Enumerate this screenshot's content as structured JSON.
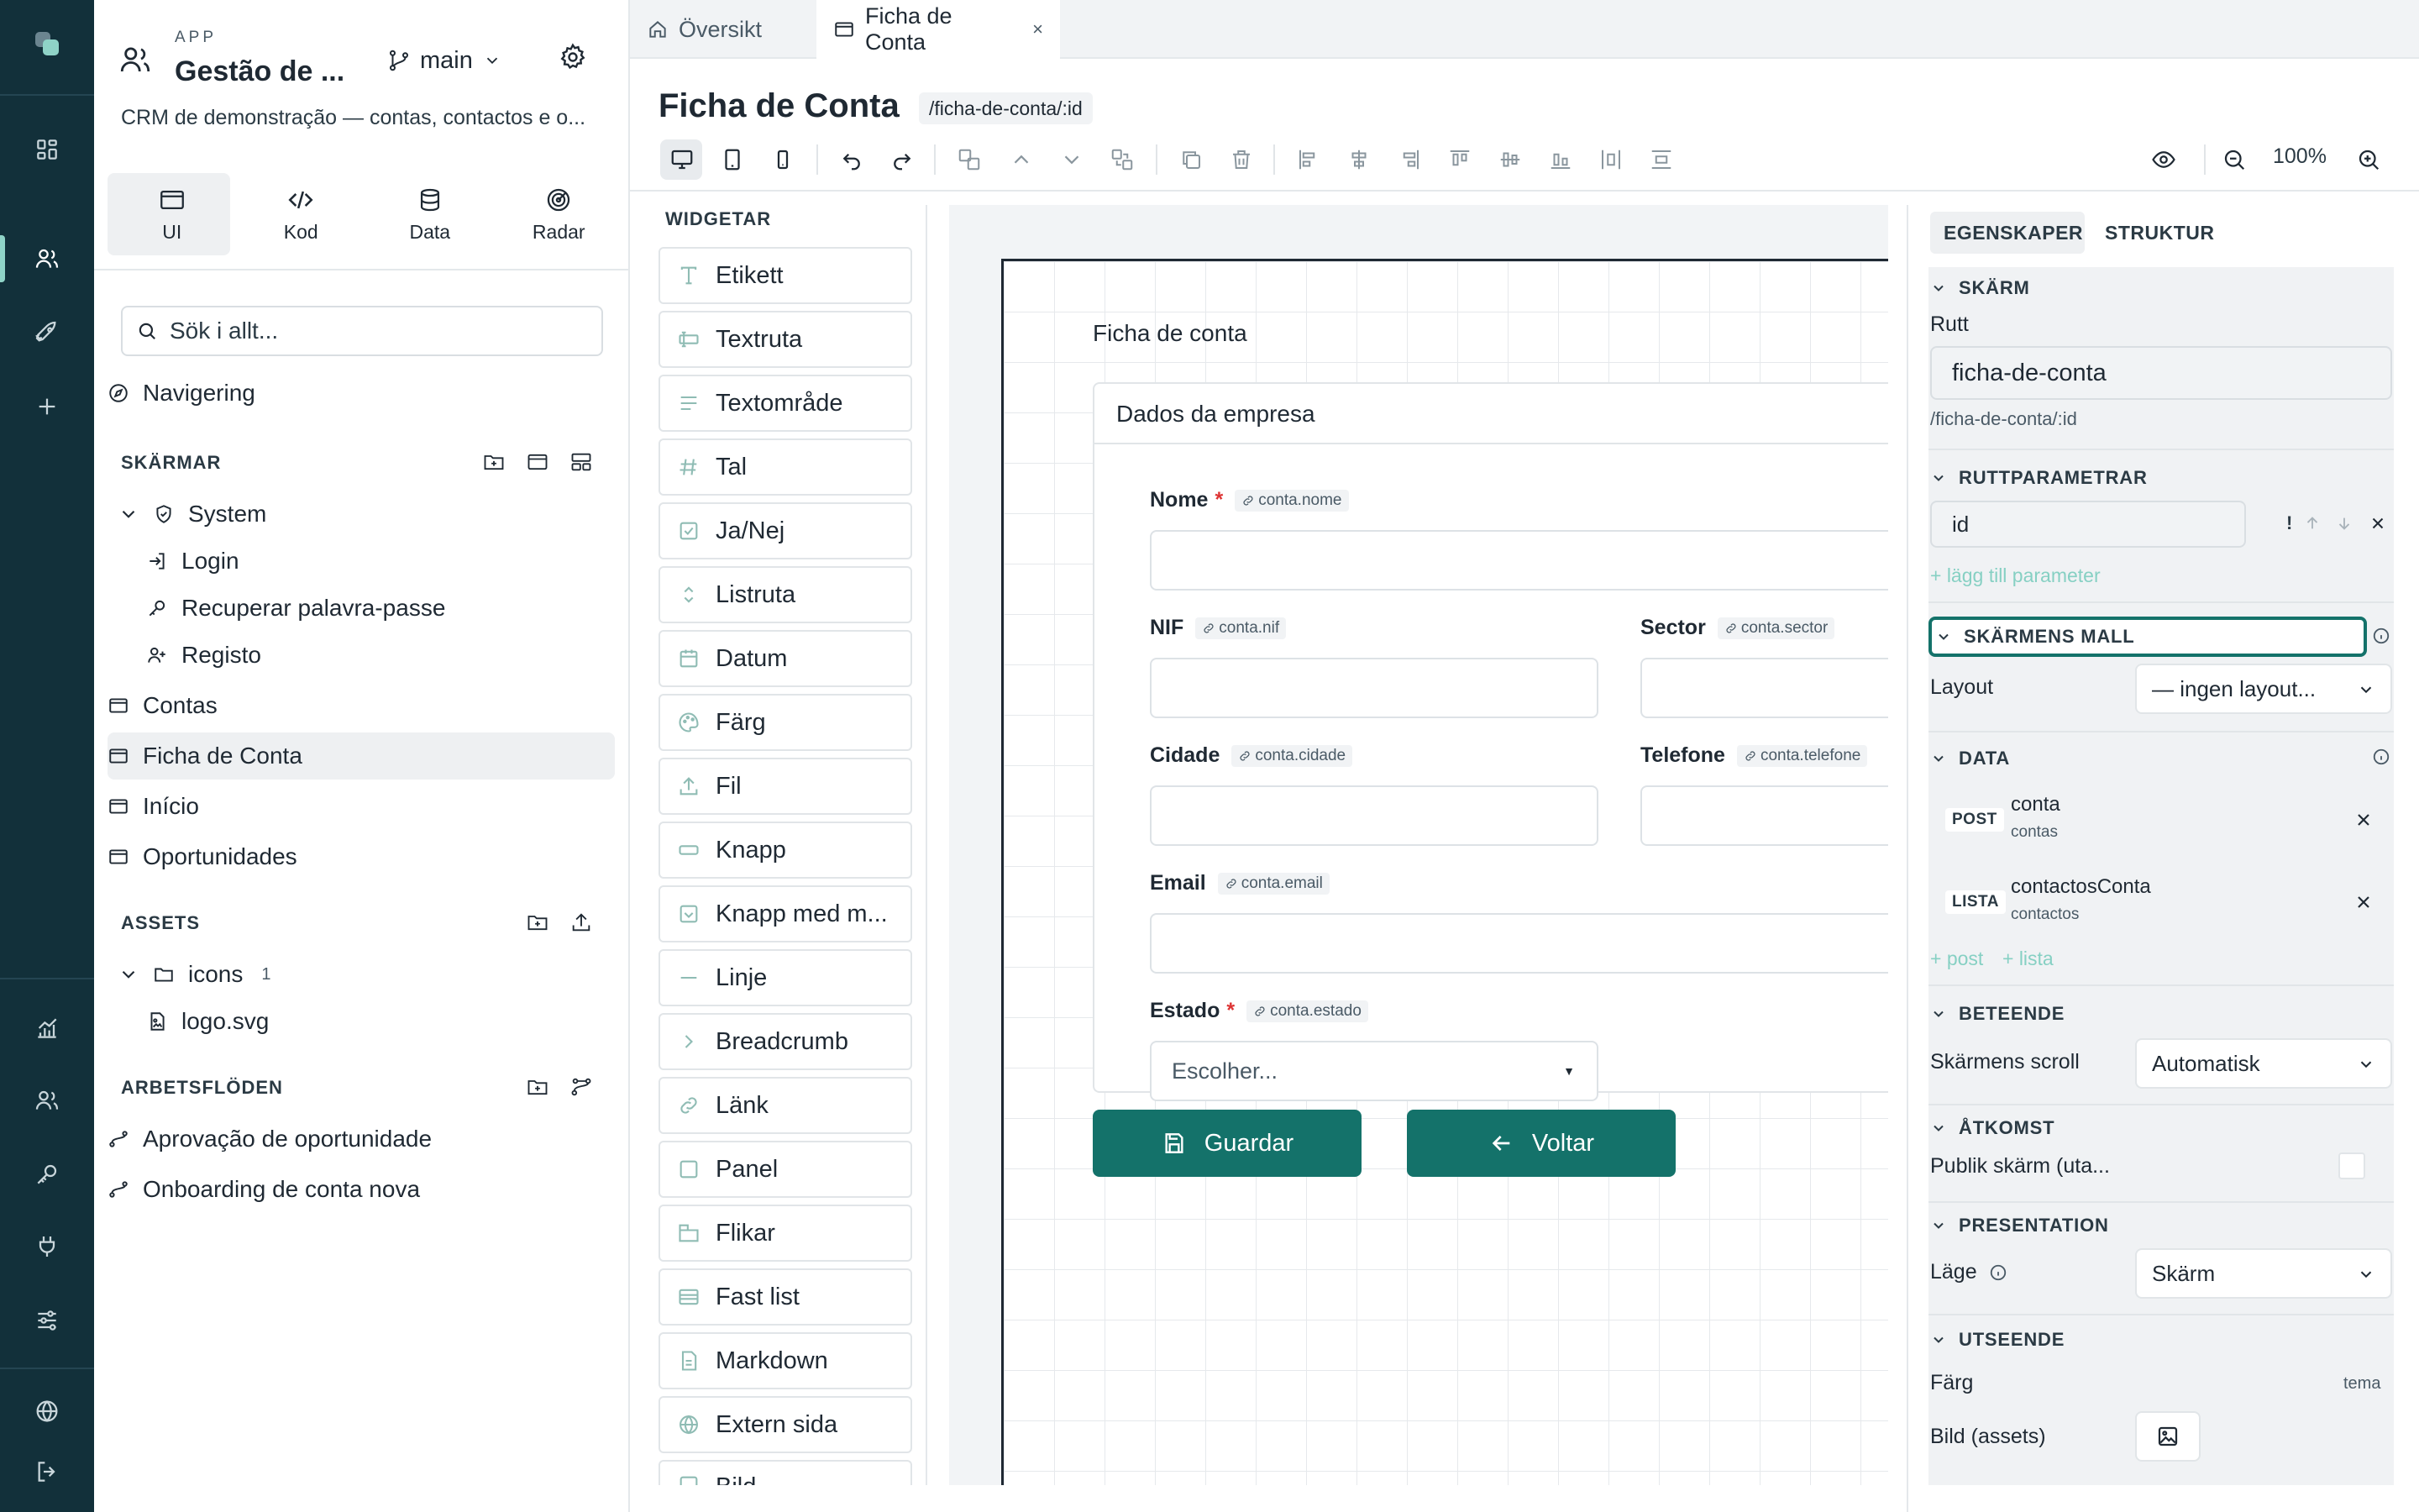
{
  "app": {
    "kicker": "APP",
    "name": "Gestão de ...",
    "branch": "main",
    "description": "CRM de demonstração — contas, contactos e o..."
  },
  "mode_tabs": [
    {
      "label": "UI",
      "icon": "window-icon"
    },
    {
      "label": "Kod",
      "icon": "code-icon"
    },
    {
      "label": "Data",
      "icon": "database-icon"
    },
    {
      "label": "Radar",
      "icon": "radar-icon"
    }
  ],
  "search": {
    "placeholder": "Sök i allt..."
  },
  "navigation_label": "Navigering",
  "screens": {
    "title": "SKÄRMAR",
    "group": "System",
    "system_items": [
      "Login",
      "Recuperar palavra-passe",
      "Registo"
    ],
    "items": [
      "Contas",
      "Ficha de Conta",
      "Início",
      "Oportunidades"
    ],
    "selected": "Ficha de Conta"
  },
  "assets": {
    "title": "ASSETS",
    "folder": "icons",
    "folder_count": "1",
    "file": "logo.svg"
  },
  "workflows": {
    "title": "ARBETSFLÖDEN",
    "items": [
      "Aprovação de oportunidade",
      "Onboarding de conta nova"
    ]
  },
  "tabs": [
    {
      "label": "Översikt",
      "active": false
    },
    {
      "label": "Ficha de Conta",
      "active": true,
      "close": "×"
    }
  ],
  "page": {
    "title": "Ficha de Conta",
    "route": "/ficha-de-conta/:id"
  },
  "toolbar": {
    "zoom": "100%"
  },
  "widgets": {
    "title": "WIDGETAR",
    "items": [
      "Etikett",
      "Textruta",
      "Textområde",
      "Tal",
      "Ja/Nej",
      "Listruta",
      "Datum",
      "Färg",
      "Fil",
      "Knapp",
      "Knapp med m...",
      "Linje",
      "Breadcrumb",
      "Länk",
      "Panel",
      "Flikar",
      "Fast list",
      "Markdown",
      "Extern sida",
      "Bild"
    ]
  },
  "canvas": {
    "heading": "Ficha de conta",
    "panel_title": "Dados da empresa",
    "fields": {
      "nome": {
        "label": "Nome",
        "bind": "conta.nome"
      },
      "nif": {
        "label": "NIF",
        "bind": "conta.nif"
      },
      "sector": {
        "label": "Sector",
        "bind": "conta.sector"
      },
      "cidade": {
        "label": "Cidade",
        "bind": "conta.cidade"
      },
      "telefone": {
        "label": "Telefone",
        "bind": "conta.telefone"
      },
      "email": {
        "label": "Email",
        "bind": "conta.email"
      },
      "estado": {
        "label": "Estado",
        "bind": "conta.estado",
        "placeholder": "Escolher..."
      }
    },
    "required_mark": "*",
    "buttons": {
      "save": "Guardar",
      "back": "Voltar"
    }
  },
  "props": {
    "tabs": [
      "EGENSKAPER",
      "STRUKTUR"
    ],
    "screen_section": "SKÄRM",
    "route_label": "Rutt",
    "route_value": "ficha-de-conta",
    "route_hint": "/ficha-de-conta/:id",
    "params_section": "RUTTPARAMETRAR",
    "param_value": "id",
    "param_flag": "!",
    "add_param": "+ lägg till parameter",
    "template_section": "SKÄRMENS MALL",
    "layout_label": "Layout",
    "layout_value": "— ingen layout...",
    "data_section": "DATA",
    "data_items": [
      {
        "method": "POST",
        "name": "conta",
        "source": "contas"
      },
      {
        "method": "LISTA",
        "name": "contactosConta",
        "source": "contactos"
      }
    ],
    "add_post": "+ post",
    "add_list": "+ lista",
    "behavior_section": "BETEENDE",
    "scroll_label": "Skärmens scroll",
    "scroll_value": "Automatisk",
    "access_section": "ÅTKOMST",
    "public_label": "Publik skärm (uta...",
    "presentation_section": "PRESENTATION",
    "mode_label": "Läge",
    "mode_value": "Skärm",
    "appearance_section": "UTSEENDE",
    "color_label": "Färg",
    "color_value": "tema",
    "image_label": "Bild (assets)"
  },
  "colors": {
    "rail": "#12303a",
    "accent": "#14726a",
    "accent_light": "#86d0c3"
  }
}
